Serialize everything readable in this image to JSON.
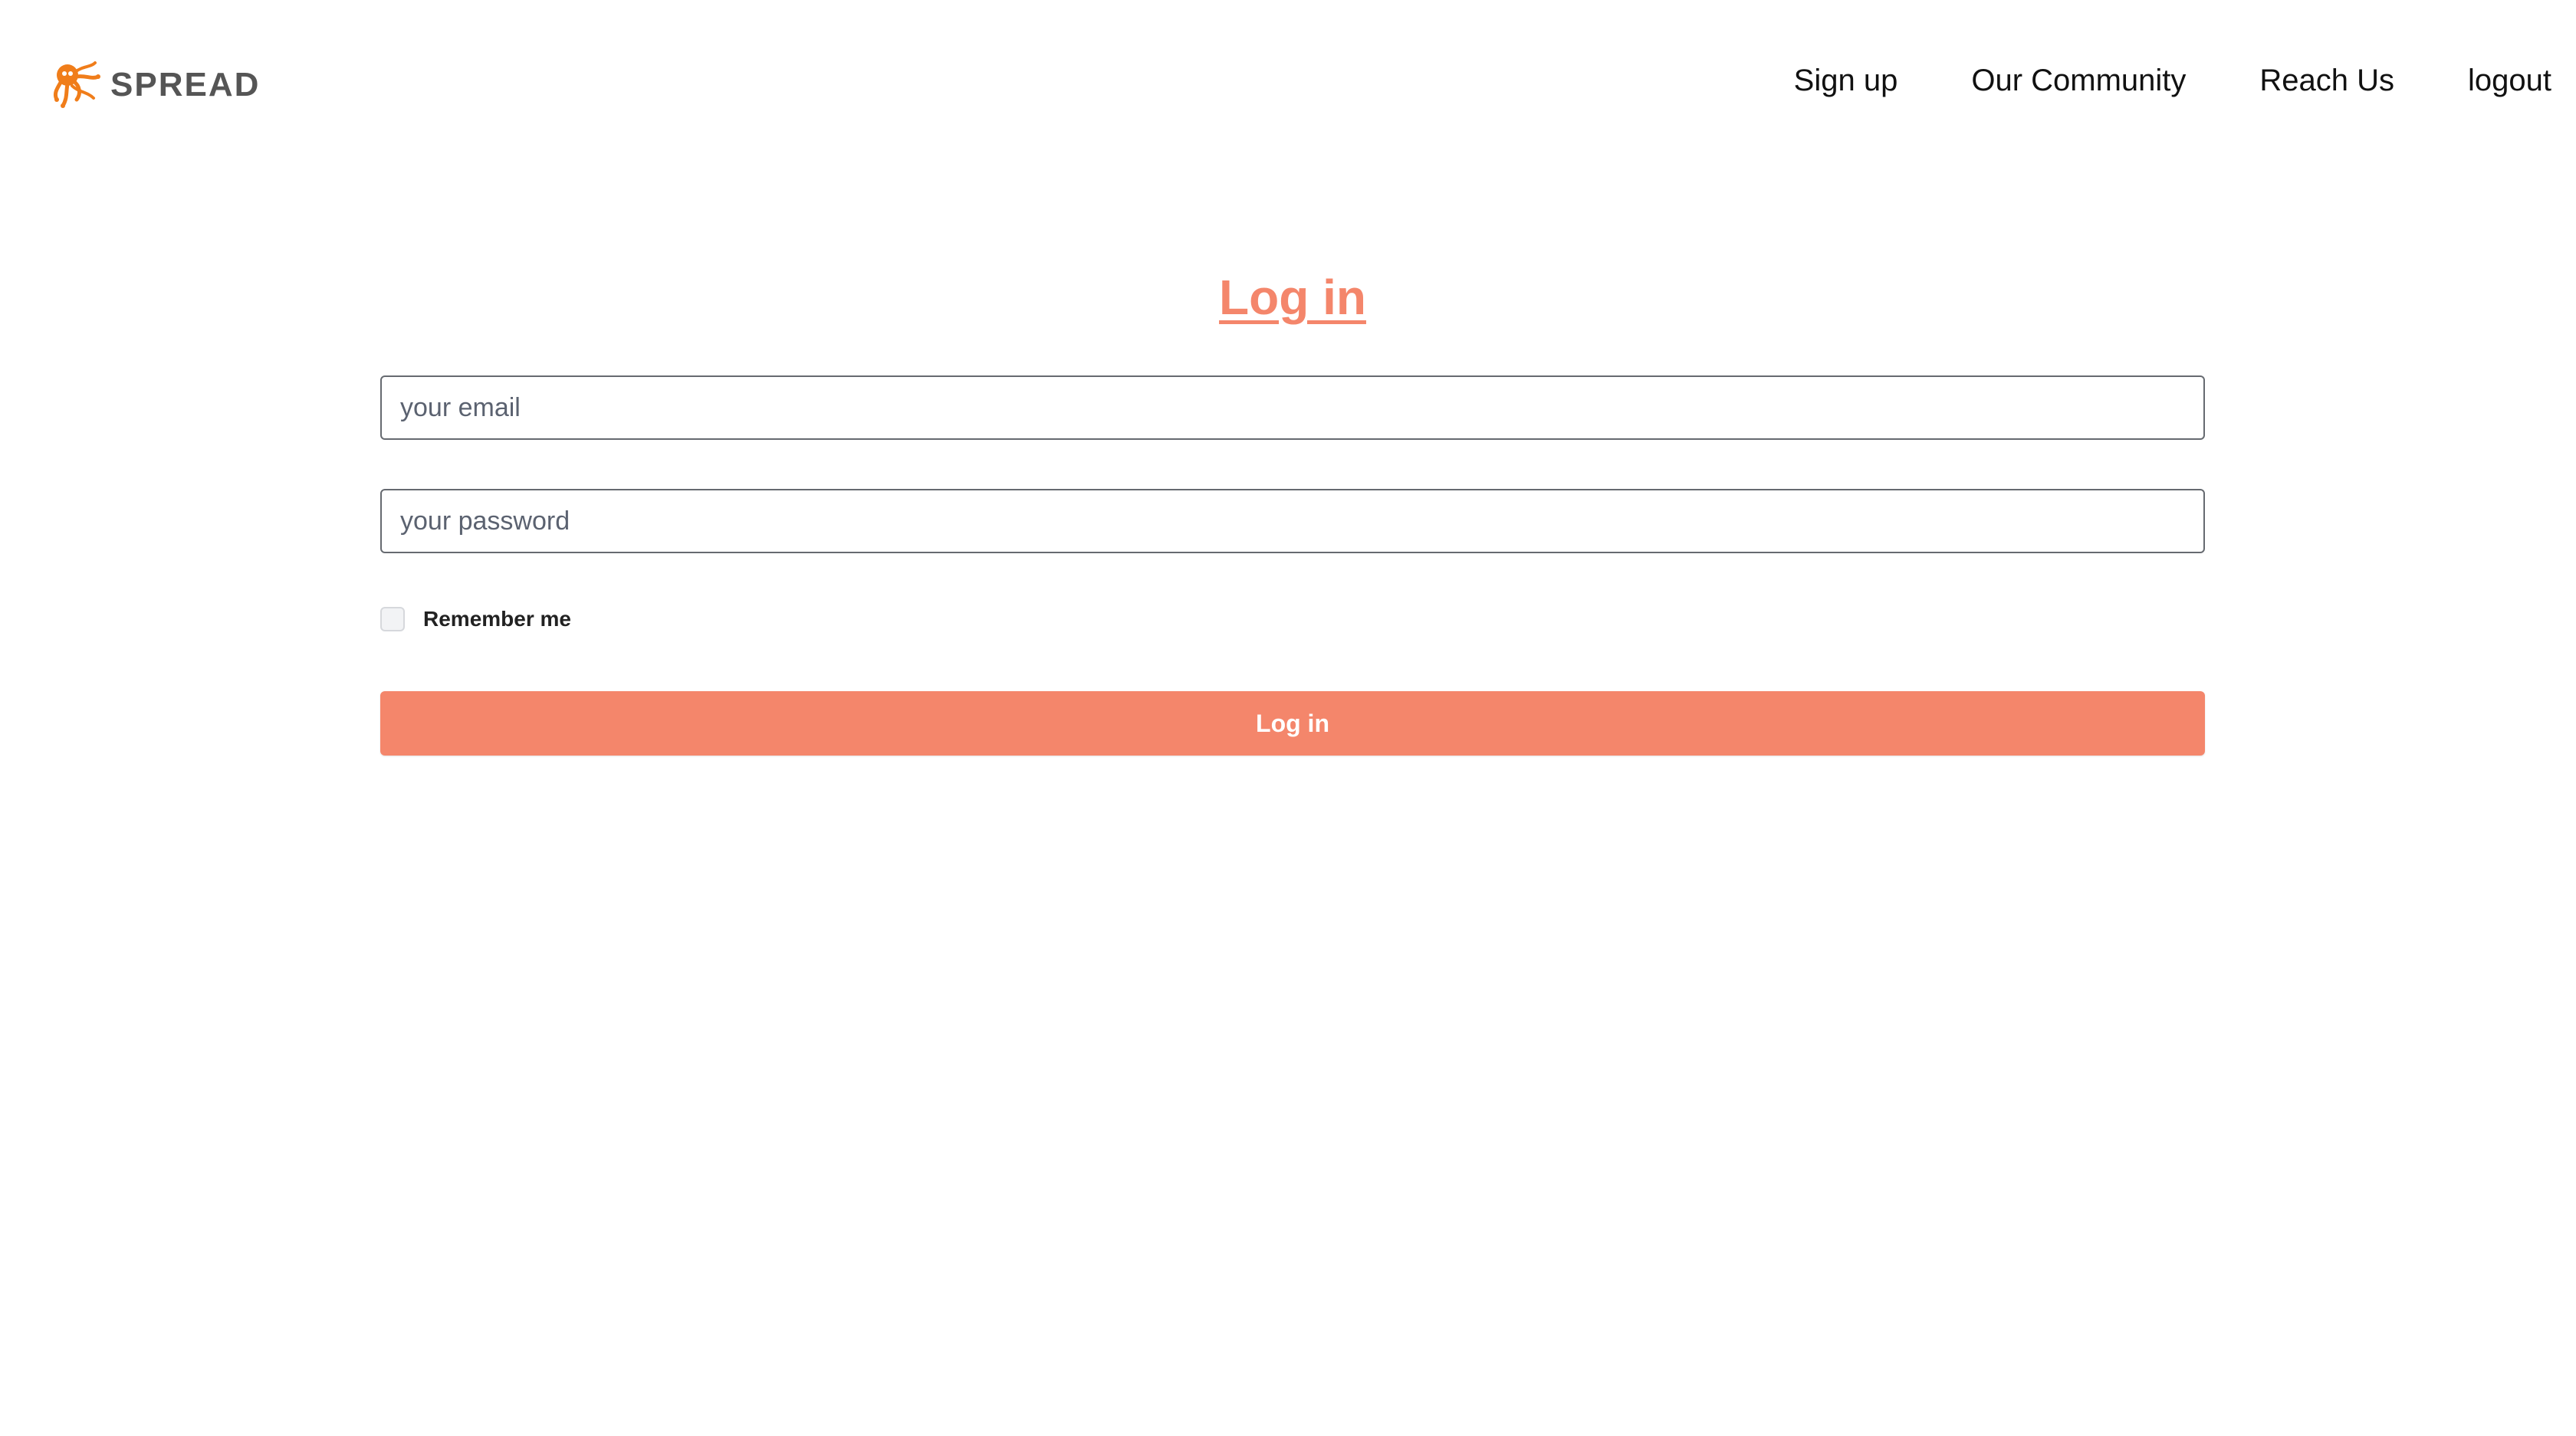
{
  "brand": {
    "name": "SPREAD",
    "icon": "octopus-icon",
    "accent_color": "#f4866b",
    "logo_color": "#f07d1a"
  },
  "nav": {
    "items": [
      {
        "label": "Sign up"
      },
      {
        "label": "Our Community"
      },
      {
        "label": "Reach Us"
      },
      {
        "label": "logout"
      }
    ]
  },
  "login": {
    "title": "Log in",
    "email_placeholder": "your email",
    "email_value": "",
    "password_placeholder": "your password",
    "password_value": "",
    "remember_label": "Remember me",
    "remember_checked": false,
    "submit_label": "Log in"
  }
}
